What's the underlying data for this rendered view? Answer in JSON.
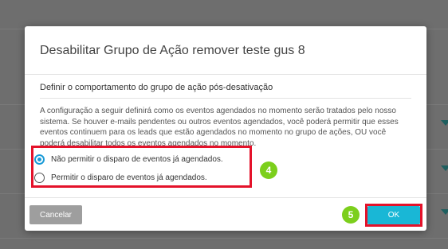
{
  "dialog": {
    "title": "Desabilitar Grupo de Ação remover teste gus 8",
    "section_title": "Definir o comportamento do grupo de ação pós-desativação",
    "description": "A configuração a seguir definirá como os eventos agendados no momento serão tratados pelo nosso sistema. Se houver e-mails pendentes ou outros eventos agendados, você poderá permitir que esses eventos continuem para os leads que estão agendados no momento no grupo de ações, OU você poderá desabilitar todos os eventos agendados no momento.",
    "options": [
      {
        "label": "Não permitir o disparo de eventos já agendados.",
        "selected": true
      },
      {
        "label": "Permitir o disparo de eventos já agendados.",
        "selected": false
      }
    ],
    "cancel_label": "Cancelar",
    "ok_label": "OK"
  },
  "annotations": {
    "options_step": "4",
    "ok_step": "5",
    "highlight_color": "#e4122a",
    "badge_color": "#7ccf1c"
  },
  "colors": {
    "radio_selected": "#1a9bd7",
    "ok_button": "#19b7d6",
    "cancel_button": "#9e9e9e",
    "overlay": "#6e6e6e"
  }
}
